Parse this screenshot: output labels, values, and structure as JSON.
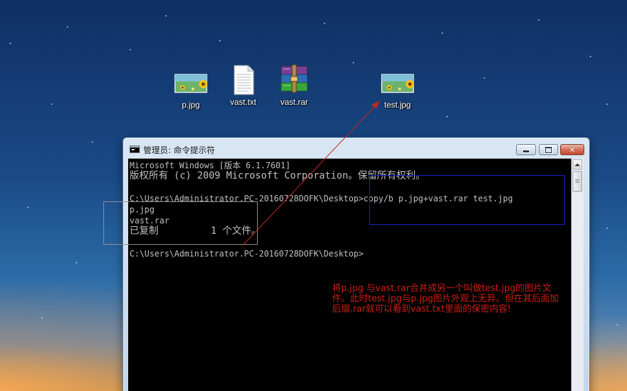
{
  "desktop": {
    "icons": [
      {
        "label": "p.jpg",
        "icon": "image-file-icon"
      },
      {
        "label": "vast.txt",
        "icon": "text-file-icon"
      },
      {
        "label": "vast.rar",
        "icon": "rar-archive-icon"
      },
      {
        "label": "test.jpg",
        "icon": "image-file-icon"
      }
    ]
  },
  "window": {
    "title": "管理员: 命令提示符",
    "controls": {
      "minimize": "minimize",
      "maximize": "maximize",
      "close": "close"
    }
  },
  "console": {
    "lines": [
      "Microsoft Windows [版本 6.1.7601]",
      "版权所有 (c) 2009 Microsoft Corporation。保留所有权利。",
      "",
      "C:\\Users\\Administrator.PC-20160728DOFK\\Desktop>copy/b p.jpg+vast.rar test.jpg",
      "p.jpg",
      "vast.rar",
      "已复制         1 个文件。",
      "",
      "C:\\Users\\Administrator.PC-20160728DOFK\\Desktop>"
    ]
  },
  "annotation": {
    "text": "将p.jpg 与vast.rar合并成另一个叫做test.jpg的图片文件。此时test.jpg与p.jpg图片外观上无异。但在其后面加后缀.rar就可以看到vast.txt里面的保密内容!",
    "color": "#d21d14"
  },
  "colors": {
    "console_bg": "#000000",
    "console_text": "#c0c0c0",
    "highlight_box": "#1d1dc9",
    "arrow": "#c0281f"
  }
}
